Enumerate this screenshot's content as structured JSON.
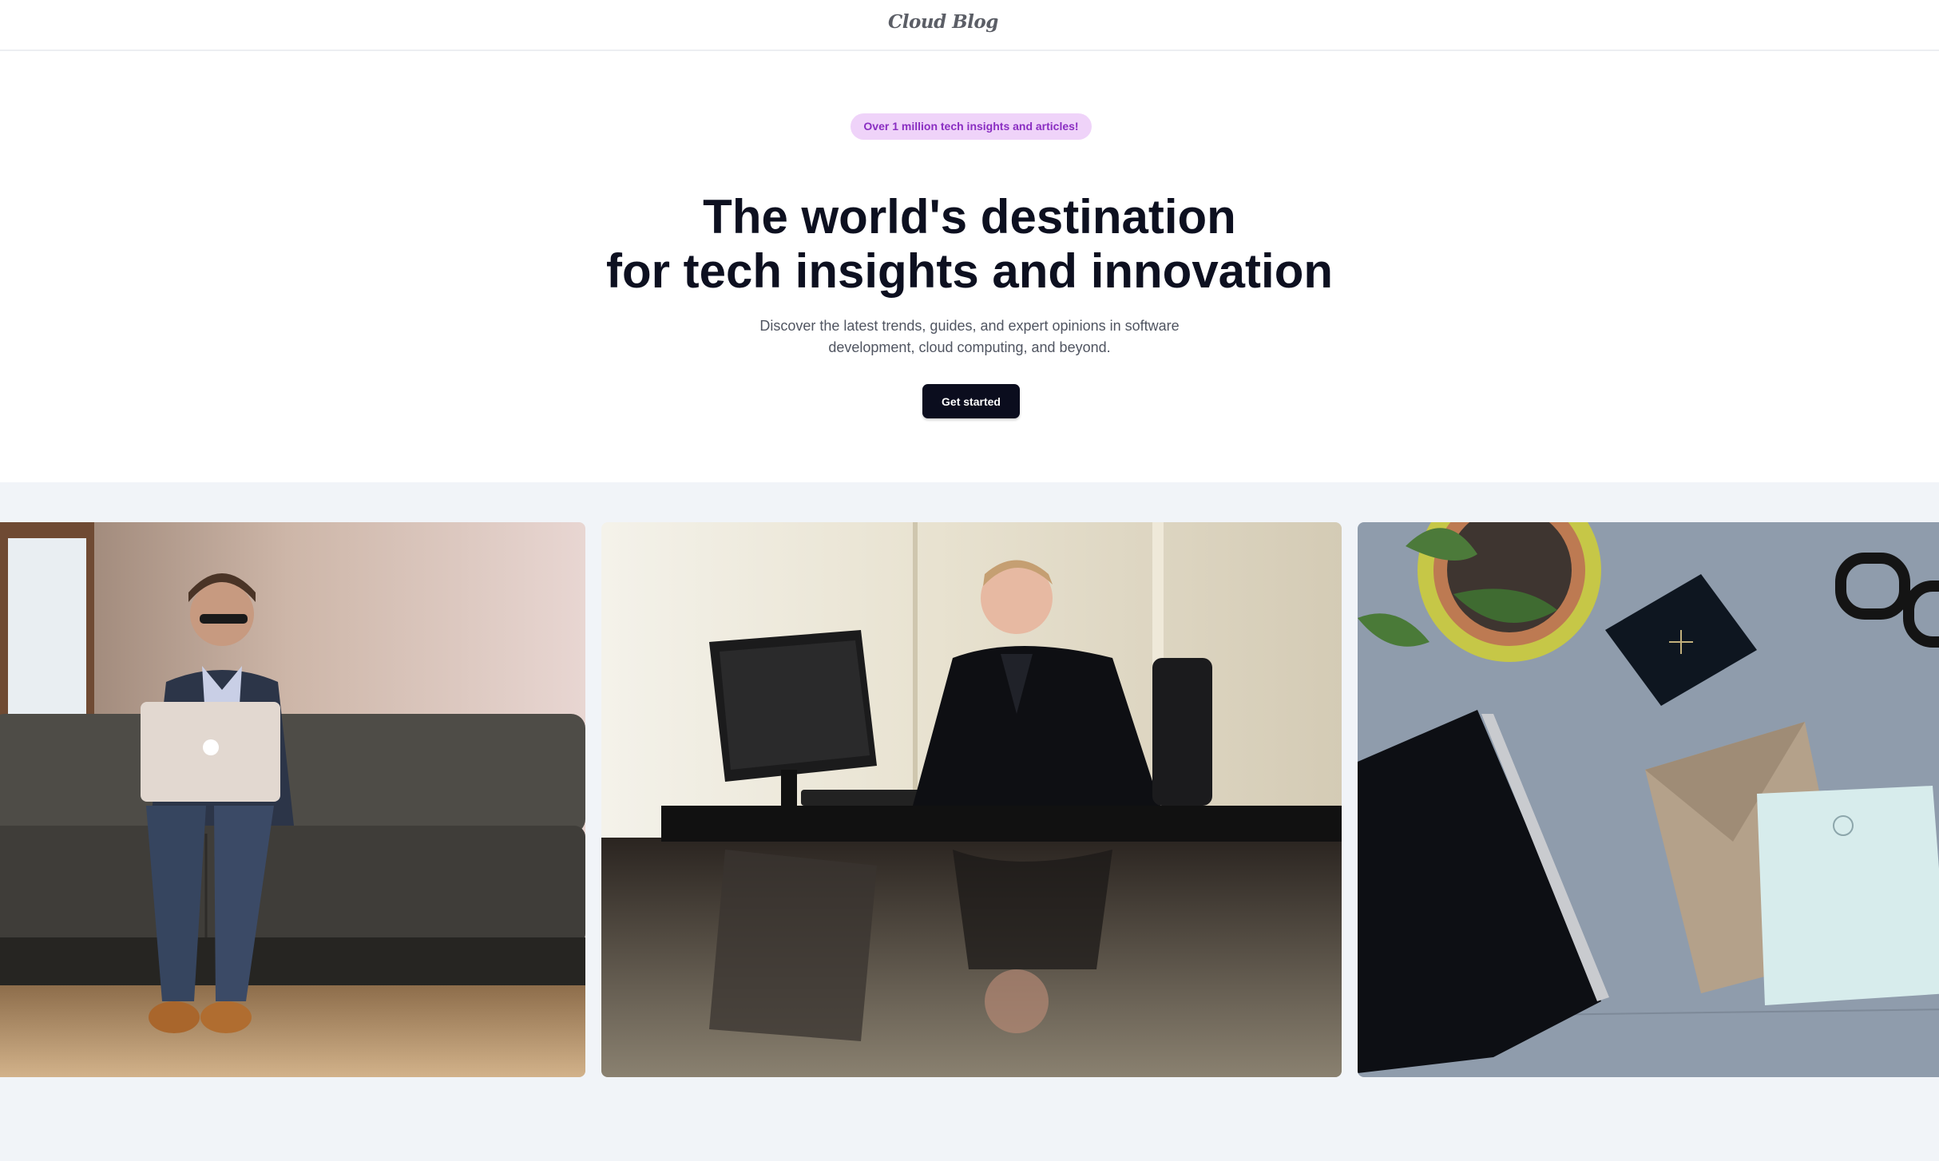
{
  "header": {
    "logo": "Cloud Blog"
  },
  "hero": {
    "badge": "Over 1 million tech insights and articles!",
    "headline_line1": "The world's destination",
    "headline_line2": "for tech insights and innovation",
    "subtitle": "Discover the latest trends, guides, and expert opinions in software development, cloud computing, and beyond.",
    "cta_label": "Get started"
  },
  "gallery": {
    "images": [
      {
        "name": "man-on-sofa-with-laptop-photo"
      },
      {
        "name": "man-at-desk-with-monitor-photo"
      },
      {
        "name": "desk-flatlay-notebook-photo"
      }
    ]
  },
  "colors": {
    "badge_bg": "#efd3f9",
    "badge_text": "#8a2ec2",
    "headline": "#0d1020",
    "cta_bg": "#0b0d1e",
    "gallery_bg": "#f1f4f8"
  }
}
